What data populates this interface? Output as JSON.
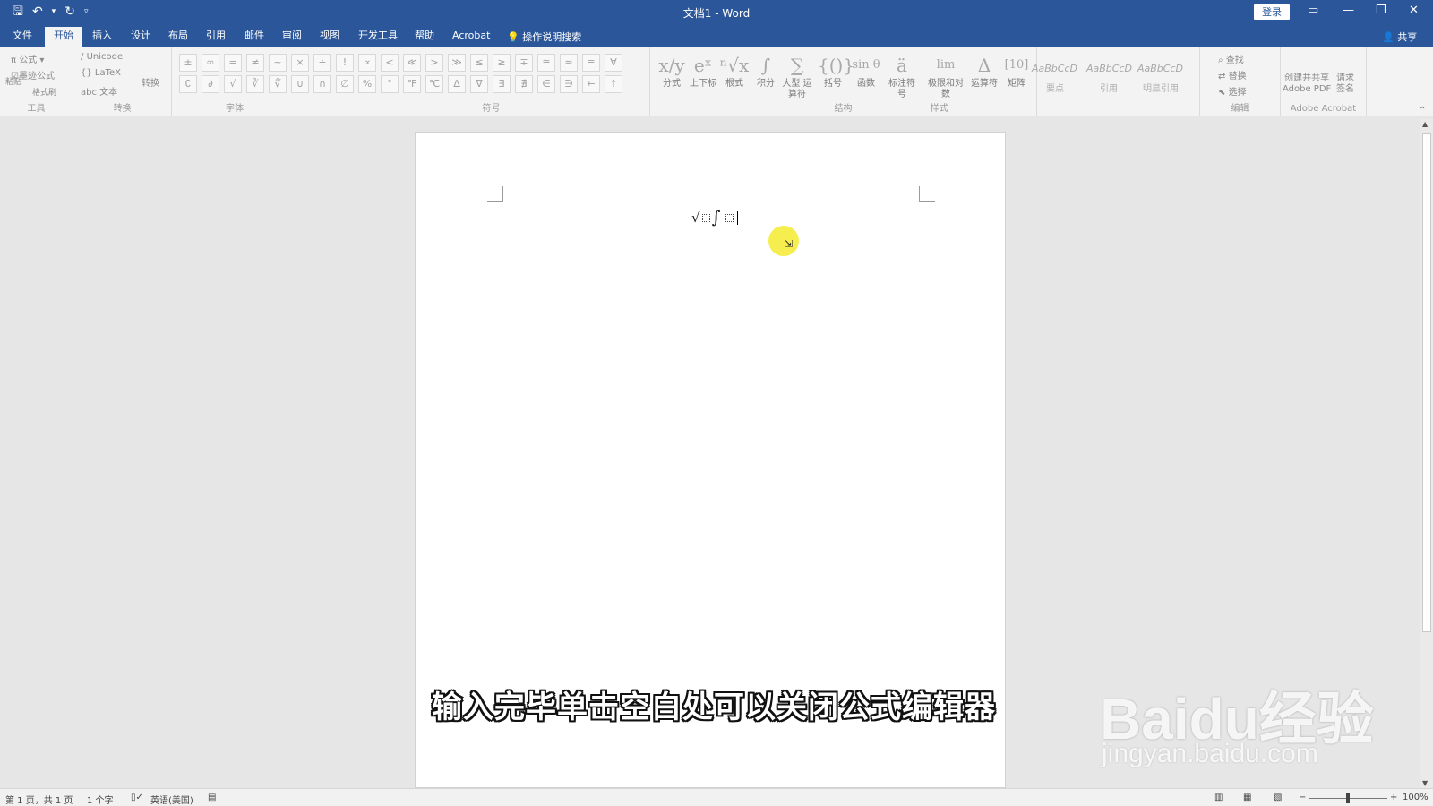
{
  "window": {
    "title": "文档1 - Word",
    "login_label": "登录",
    "controls": [
      "ribbon-display",
      "minimize",
      "restore",
      "close"
    ]
  },
  "qat": {
    "save_icon": "save-icon",
    "undo_icon": "undo-icon",
    "redo_icon": "redo-icon",
    "customize_icon": "chevron-down-icon"
  },
  "tabs": [
    {
      "label": "文件"
    },
    {
      "label": "开始",
      "active": true
    },
    {
      "label": "插入"
    },
    {
      "label": "设计"
    },
    {
      "label": "布局"
    },
    {
      "label": "引用"
    },
    {
      "label": "邮件"
    },
    {
      "label": "审阅"
    },
    {
      "label": "视图"
    },
    {
      "label": "开发工具"
    },
    {
      "label": "帮助"
    },
    {
      "label": "Acrobat"
    }
  ],
  "tell_me": "操作说明搜索",
  "share_label": "共享",
  "ribbon": {
    "tools": {
      "formula": "公式",
      "ink": "墨迹公式",
      "paste": "粘贴",
      "format_painter": "格式刷",
      "group": "工具"
    },
    "convert": {
      "unicode": "Unicode",
      "latex": "LaTeX",
      "text": "abc 文本",
      "convert": "转换",
      "group": "转换"
    },
    "font_group": "字体",
    "symbols": {
      "row1": [
        "±",
        "∞",
        "=",
        "≠",
        "~",
        "×",
        "÷",
        "!",
        "∝",
        "<",
        "≪",
        ">",
        "≫",
        "≤",
        "≥",
        "∓",
        "≅",
        "≈",
        "≡",
        "∀"
      ],
      "row2": [
        "∁",
        "∂",
        "√",
        "∛",
        "∜",
        "∪",
        "∩",
        "∅",
        "%",
        "°",
        "℉",
        "℃",
        "∆",
        "∇",
        "∃",
        "∄",
        "∈",
        "∋",
        "←",
        "↑"
      ],
      "group": "符号"
    },
    "structures": [
      {
        "icon": "x/y",
        "label": "分式"
      },
      {
        "icon": "eˣ",
        "label": "上下标"
      },
      {
        "icon": "ⁿ√x",
        "label": "根式"
      },
      {
        "icon": "∫",
        "label": "积分"
      },
      {
        "icon": "∑",
        "label": "大型\n运算符"
      },
      {
        "icon": "{()}",
        "label": "括号"
      },
      {
        "icon": "sin θ",
        "label": "函数"
      },
      {
        "icon": "ä",
        "label": "标注符号"
      },
      {
        "icon": "lim",
        "label": "极限和对数"
      },
      {
        "icon": "Δ",
        "label": "运算符"
      },
      {
        "icon": "[10]",
        "label": "矩阵"
      }
    ],
    "structure_group": "结构",
    "styles": {
      "items": [
        "AaBbCcD",
        "AaBbCcD",
        "AaBbCcD"
      ],
      "labels": [
        "要点",
        "引用",
        "明显引用"
      ],
      "group": "样式"
    },
    "editing": {
      "find": "查找",
      "replace": "替换",
      "select": "选择",
      "group": "编辑"
    },
    "acrobat": {
      "create": "创建并共享\nAdobe PDF",
      "sign": "请求\n签名",
      "group": "Adobe Acrobat"
    }
  },
  "document": {
    "equation": {
      "radical": "√",
      "integral": "∫"
    }
  },
  "overlay": {
    "caption": "输入完毕单击空白处可以关闭公式编辑器",
    "watermark_logo": "Baidu经验",
    "watermark_url": "jingyan.baidu.com"
  },
  "status": {
    "page": "第 1 页，共 1 页",
    "words": "1 个字",
    "language": "英语(美国)",
    "zoom": "100%",
    "zoom_fraction": 0.5
  }
}
